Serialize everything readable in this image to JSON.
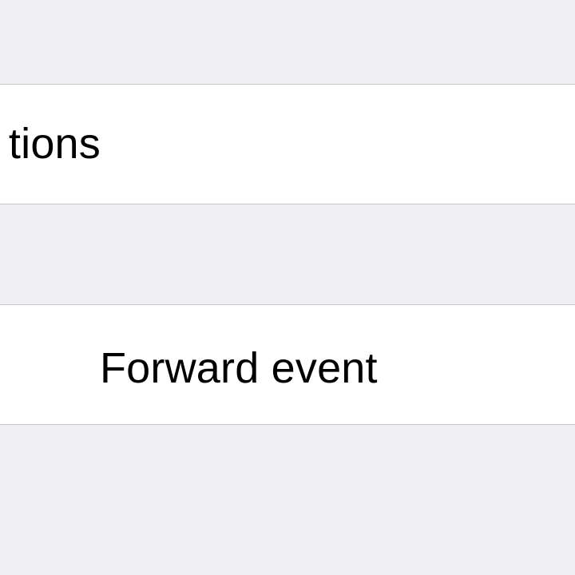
{
  "settings": {
    "rows": [
      {
        "label": "tions"
      },
      {
        "label": "Forward event"
      }
    ]
  },
  "colors": {
    "background": "#efeff4",
    "row_background": "#ffffff",
    "separator": "#c8c7cc",
    "text": "#000000"
  }
}
